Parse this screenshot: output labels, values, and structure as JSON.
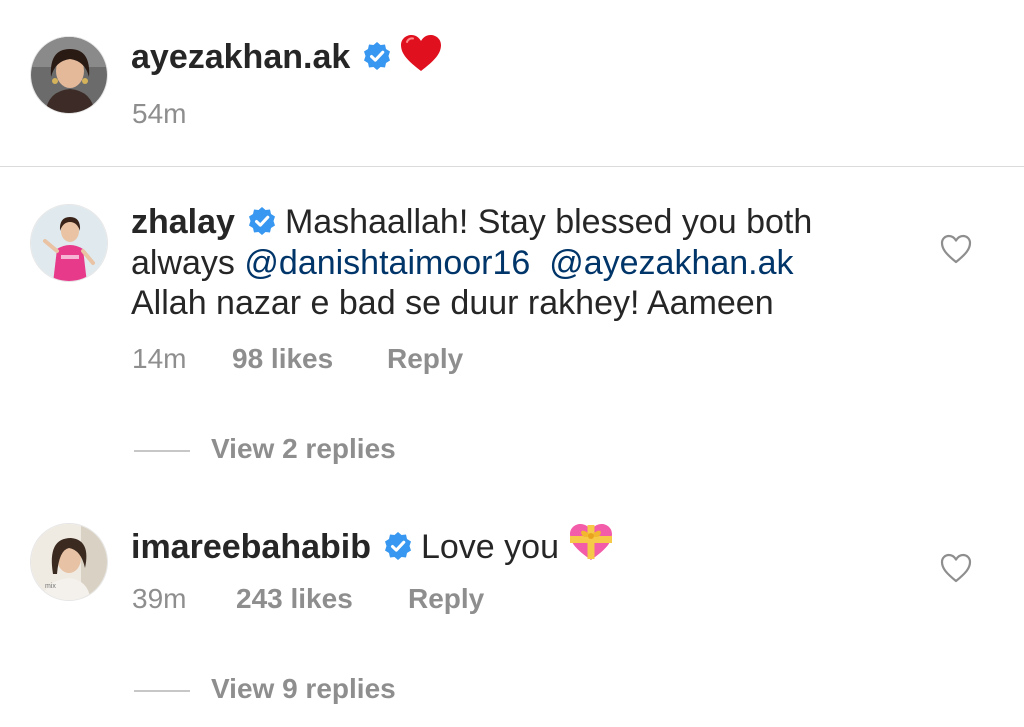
{
  "post": {
    "username": "ayezakhan.ak",
    "caption_emoji": "red-heart-icon",
    "time": "54m"
  },
  "comments": [
    {
      "username": "zhalay",
      "text_line1": "Mashaallah! Stay blessed you both",
      "text_line2_prefix": "always",
      "mention1": "@danishtaimoor16",
      "mention2": "@ayezakhan.ak",
      "text_line3": "Allah nazar e bad se duur rakhey! Aameen",
      "time": "14m",
      "likes": "98 likes",
      "reply": "Reply",
      "view_replies": "View 2 replies"
    },
    {
      "username": "imareebahabib",
      "text": "Love you",
      "emoji": "heart-with-ribbon-icon",
      "time": "39m",
      "likes": "243 likes",
      "reply": "Reply",
      "view_replies": "View 9 replies"
    }
  ],
  "colors": {
    "text": "#262626",
    "muted": "#8e8e8e",
    "mention": "#003569",
    "verified": "#3897f0",
    "heart": "#ed1c24"
  }
}
